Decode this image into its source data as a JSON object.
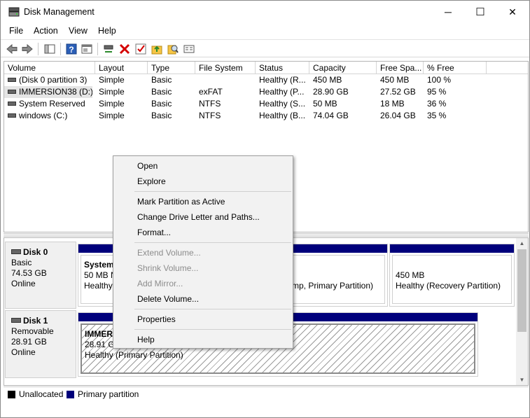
{
  "window": {
    "title": "Disk Management",
    "minimize": "─",
    "maximize": "☐",
    "close": "✕"
  },
  "menu": [
    "File",
    "Action",
    "View",
    "Help"
  ],
  "toolbar": {
    "icons": [
      "back-arrow-icon",
      "forward-arrow-icon",
      "console-tree-icon",
      "help-icon",
      "properties-panel-icon",
      "connect-icon",
      "delete-icon",
      "check-icon",
      "folder-up-icon",
      "search-icon",
      "list-icon"
    ],
    "colors": {
      "delete": "#d40000",
      "help": "#2b5fb8",
      "folder": "#f6c544"
    }
  },
  "volumes": {
    "headers": [
      "Volume",
      "Layout",
      "Type",
      "File System",
      "Status",
      "Capacity",
      "Free Spa...",
      "% Free"
    ],
    "rows": [
      [
        "(Disk 0 partition 3)",
        "Simple",
        "Basic",
        "",
        "Healthy (R...",
        "450 MB",
        "450 MB",
        "100 %"
      ],
      [
        "IMMERSION38 (D:)",
        "Simple",
        "Basic",
        "exFAT",
        "Healthy (P...",
        "28.90 GB",
        "27.52 GB",
        "95 %"
      ],
      [
        "System Reserved",
        "Simple",
        "Basic",
        "NTFS",
        "Healthy (S...",
        "50 MB",
        "18 MB",
        "36 %"
      ],
      [
        "windows (C:)",
        "Simple",
        "Basic",
        "NTFS",
        "Healthy (B...",
        "74.04 GB",
        "26.04 GB",
        "35 %"
      ]
    ]
  },
  "disks": [
    {
      "name": "Disk 0",
      "type": "Basic",
      "size": "74.53 GB",
      "status": "Online",
      "partitions": [
        {
          "line1": "System",
          "line2": "50 MB N",
          "line3": "Healthy"
        },
        {
          "line1": "",
          "line2": "",
          "line3": "mp, Primary Partition)"
        },
        {
          "line1": "",
          "line2": "450 MB",
          "line3": "Healthy (Recovery Partition)"
        }
      ]
    },
    {
      "name": "Disk 1",
      "type": "Removable",
      "size": "28.91 GB",
      "status": "Online",
      "partitions": [
        {
          "line1": "IMMERS",
          "line2": "28.91 GB",
          "line3": "Healthy (Primary Partition)"
        }
      ]
    }
  ],
  "legend": [
    {
      "label": "Unallocated",
      "color": "#000000"
    },
    {
      "label": "Primary partition",
      "color": "#00007b"
    }
  ],
  "context_menu": {
    "items": [
      {
        "label": "Open",
        "enabled": true
      },
      {
        "label": "Explore",
        "enabled": true
      },
      {
        "label": "Mark Partition as Active",
        "enabled": true
      },
      {
        "label": "Change Drive Letter and Paths...",
        "enabled": true
      },
      {
        "label": "Format...",
        "enabled": true
      },
      {
        "label": "Extend Volume...",
        "enabled": false
      },
      {
        "label": "Shrink Volume...",
        "enabled": false
      },
      {
        "label": "Add Mirror...",
        "enabled": false
      },
      {
        "label": "Delete Volume...",
        "enabled": true
      },
      {
        "label": "Properties",
        "enabled": true
      },
      {
        "label": "Help",
        "enabled": true
      }
    ]
  },
  "scroll": {
    "up": "▲",
    "down": "▼"
  }
}
